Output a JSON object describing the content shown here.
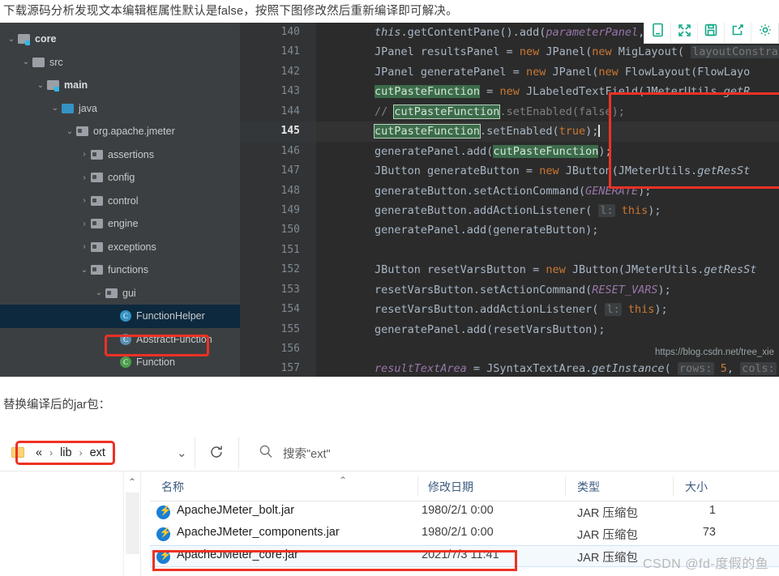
{
  "article": {
    "intro_line": "下载源码分析发现文本编辑框属性默认是false，按照下图修改然后重新编译即可解决。",
    "caption_jar": "替换编译后的jar包："
  },
  "ide": {
    "toolbar": [
      {
        "name": "mobile-preview-icon",
        "label": "mobile"
      },
      {
        "name": "fullscreen-icon",
        "label": "fullscreen"
      },
      {
        "name": "save-icon",
        "label": "save"
      },
      {
        "name": "share-icon",
        "label": "share"
      },
      {
        "name": "settings-icon",
        "label": "settings"
      }
    ],
    "watermark": "https://blog.csdn.net/tree_xie",
    "tree": [
      {
        "label": "core",
        "indent": 0,
        "arrow": "v",
        "icon": "folder-module",
        "bold": true
      },
      {
        "label": "src",
        "indent": 1,
        "arrow": "v",
        "icon": "folder-gray",
        "bold": false
      },
      {
        "label": "main",
        "indent": 2,
        "arrow": "v",
        "icon": "folder-module",
        "bold": true
      },
      {
        "label": "java",
        "indent": 3,
        "arrow": "v",
        "icon": "folder-blue",
        "bold": false
      },
      {
        "label": "org.apache.jmeter",
        "indent": 4,
        "arrow": "v",
        "icon": "folder-package",
        "bold": false
      },
      {
        "label": "assertions",
        "indent": 5,
        "arrow": ">",
        "icon": "folder-package",
        "bold": false
      },
      {
        "label": "config",
        "indent": 5,
        "arrow": ">",
        "icon": "folder-package",
        "bold": false
      },
      {
        "label": "control",
        "indent": 5,
        "arrow": ">",
        "icon": "folder-package",
        "bold": false
      },
      {
        "label": "engine",
        "indent": 5,
        "arrow": ">",
        "icon": "folder-package",
        "bold": false
      },
      {
        "label": "exceptions",
        "indent": 5,
        "arrow": ">",
        "icon": "folder-package",
        "bold": false
      },
      {
        "label": "functions",
        "indent": 5,
        "arrow": "v",
        "icon": "folder-package",
        "bold": false
      },
      {
        "label": "gui",
        "indent": 6,
        "arrow": "v",
        "icon": "folder-package",
        "bold": false
      },
      {
        "label": "FunctionHelper",
        "indent": 7,
        "arrow": "",
        "icon": "class-blue",
        "bold": false,
        "selected": true
      },
      {
        "label": "AbstractFunction",
        "indent": 7,
        "arrow": "",
        "icon": "class-faded",
        "bold": false
      },
      {
        "label": "Function",
        "indent": 7,
        "arrow": "",
        "icon": "class-green",
        "bold": false
      }
    ],
    "editor": {
      "first_line_number": 140,
      "current_line": 145,
      "lines": [
        {
          "n": 140,
          "html": "<span class=\"mth\">this</span>.getContentPane().add(<span class=\"cst\">parameterPanel</span>, BorderLayout.<span class=\"cst\">CE</span>"
        },
        {
          "n": 141,
          "html": "JPanel resultsPanel = <span class=\"kw\">new</span> JPanel(<span class=\"kw\">new</span> MigLayout( <span class=\"hint\">layoutConstra</span>"
        },
        {
          "n": 142,
          "html": "JPanel generatePanel = <span class=\"kw\">new</span> JPanel(<span class=\"kw\">new</span> FlowLayout(FlowLayo"
        },
        {
          "n": 143,
          "html": "<span class=\"sel-tok\">cutPasteFunction</span> = <span class=\"kw\">new</span> JLabeledTextField(JMeterUtils.<span class=\"mth\">getR</span>"
        },
        {
          "n": 144,
          "html": "<span class=\"cm\">// </span><span class=\"sel-tok ring\">cutPasteFunction</span><span class=\"cm\">.setEnabled(false);</span>"
        },
        {
          "n": 145,
          "html": "<span class=\"sel-tok ring\">cutPasteFunction</span>.setEnabled(<span class=\"kw\">true</span>);<span class=\"caret\"></span>"
        },
        {
          "n": 146,
          "html": "generatePanel.add(<span class=\"sel-tok\">cutPasteFunction</span>);"
        },
        {
          "n": 147,
          "html": "JButton generateButton = <span class=\"kw\">new</span> JButton(JMeterUtils.<span class=\"mth\">getResSt</span>"
        },
        {
          "n": 148,
          "html": "generateButton.setActionCommand(<span class=\"cst\">GENERATE</span>);"
        },
        {
          "n": 149,
          "html": "generateButton.addActionListener( <span class=\"hint\">l:</span> <span class=\"kw\">this</span>);"
        },
        {
          "n": 150,
          "html": "generatePanel.add(generateButton);"
        },
        {
          "n": 151,
          "html": ""
        },
        {
          "n": 152,
          "html": "JButton resetVarsButton = <span class=\"kw\">new</span> JButton(JMeterUtils.<span class=\"mth\">getResSt</span>"
        },
        {
          "n": 153,
          "html": "resetVarsButton.setActionCommand(<span class=\"cst\">RESET_VARS</span>);"
        },
        {
          "n": 154,
          "html": "resetVarsButton.addActionListener( <span class=\"hint\">l:</span> <span class=\"kw\">this</span>);"
        },
        {
          "n": 155,
          "html": "generatePanel.add(resetVarsButton);"
        },
        {
          "n": 156,
          "html": ""
        },
        {
          "n": 157,
          "html": "<span class=\"cst\">resultTextArea</span> = JSyntaxTextArea.<span class=\"mth\">getInstance</span>( <span class=\"hint\">rows:</span> <span class=\"kw\">5</span>,  <span class=\"hint\">cols:</span>"
        }
      ]
    }
  },
  "explorer": {
    "breadcrumb": [
      "«",
      "lib",
      "ext"
    ],
    "breadcrumb_seps": [
      "",
      "›"
    ],
    "search_placeholder": "搜索\"ext\"",
    "columns": [
      {
        "key": "name",
        "label": "名称"
      },
      {
        "key": "date",
        "label": "修改日期"
      },
      {
        "key": "type",
        "label": "类型"
      },
      {
        "key": "size",
        "label": "大小"
      }
    ],
    "rows": [
      {
        "name": "ApacheJMeter_bolt.jar",
        "date": "1980/2/1 0:00",
        "type": "JAR 压缩包",
        "size": "1",
        "selected": false
      },
      {
        "name": "ApacheJMeter_components.jar",
        "date": "1980/2/1 0:00",
        "type": "JAR 压缩包",
        "size": "73",
        "selected": false
      },
      {
        "name": "ApacheJMeter_core.jar",
        "date": "2021/7/3 11:41",
        "type": "JAR 压缩包",
        "size": "",
        "selected": true
      }
    ],
    "watermark": "CSDN @fd-度假的鱼"
  },
  "colors": {
    "highlight_red": "#ee3124",
    "accent_teal": "#13a888",
    "ide_bg": "#3c3f41",
    "editor_bg": "#2b2b2b",
    "selection_green": "#3c6b4a"
  }
}
